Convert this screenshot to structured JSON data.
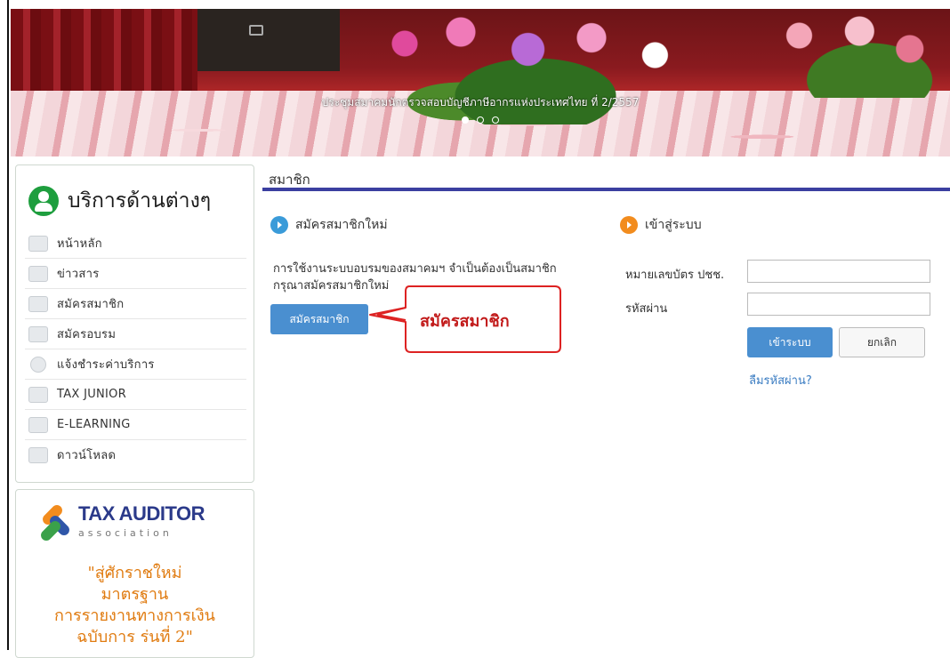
{
  "banner": {
    "caption": "ประชุมสมาคมนักตรวจสอบบัญชีภาษีอากรแห่งประเทศไทย ที่ 2/2557",
    "slide_count": 3,
    "active_slide": 1
  },
  "sidebar": {
    "title": "บริการด้านต่างๆ",
    "items": [
      {
        "label": "หน้าหลัก",
        "icon": "home-icon"
      },
      {
        "label": "ข่าวสาร",
        "icon": "news-icon"
      },
      {
        "label": "สมัครสมาชิก",
        "icon": "members-icon"
      },
      {
        "label": "สมัครอบรม",
        "icon": "training-icon"
      },
      {
        "label": "แจ้งชำระค่าบริการ",
        "icon": "payment-icon"
      },
      {
        "label": "TAX JUNIOR",
        "icon": "junior-icon"
      },
      {
        "label": "E-LEARNING",
        "icon": "elearning-icon"
      },
      {
        "label": "ดาวน์โหลด",
        "icon": "download-icon"
      }
    ]
  },
  "ad": {
    "logo_main": "TAX AUDITOR",
    "logo_sub": "association",
    "promo_lines": [
      "\"สู่ศักราชใหม่",
      "มาตรฐาน",
      "การรายงานทางการเงิน",
      "ฉบับการ ร่นที่ 2\""
    ]
  },
  "main": {
    "section_title": "สมาชิก",
    "register": {
      "heading": "สมัครสมาชิกใหม่",
      "description": "การใช้งานระบบอบรมของสมาคมฯ จำเป็นต้องเป็นสมาชิก กรุณาสมัครสมาชิกใหม่",
      "button_label": "สมัครสมาชิก",
      "callout_text": "สมัครสมาชิก"
    },
    "login": {
      "heading": "เข้าสู่ระบบ",
      "id_label": "หมายเลขบัตร ปชช.",
      "id_value": "",
      "password_label": "รหัสผ่าน",
      "password_value": "",
      "login_button": "เข้าระบบ",
      "cancel_button": "ยกเลิก",
      "forgot_link": "ลืมรหัสผ่าน?"
    }
  },
  "colors": {
    "accent_blue": "#4a8fd0",
    "rule_navy": "#3b3fa0",
    "sidebar_green": "#1e9e3e",
    "callout_red": "#c21b1b",
    "promo_orange": "#e07b10"
  }
}
